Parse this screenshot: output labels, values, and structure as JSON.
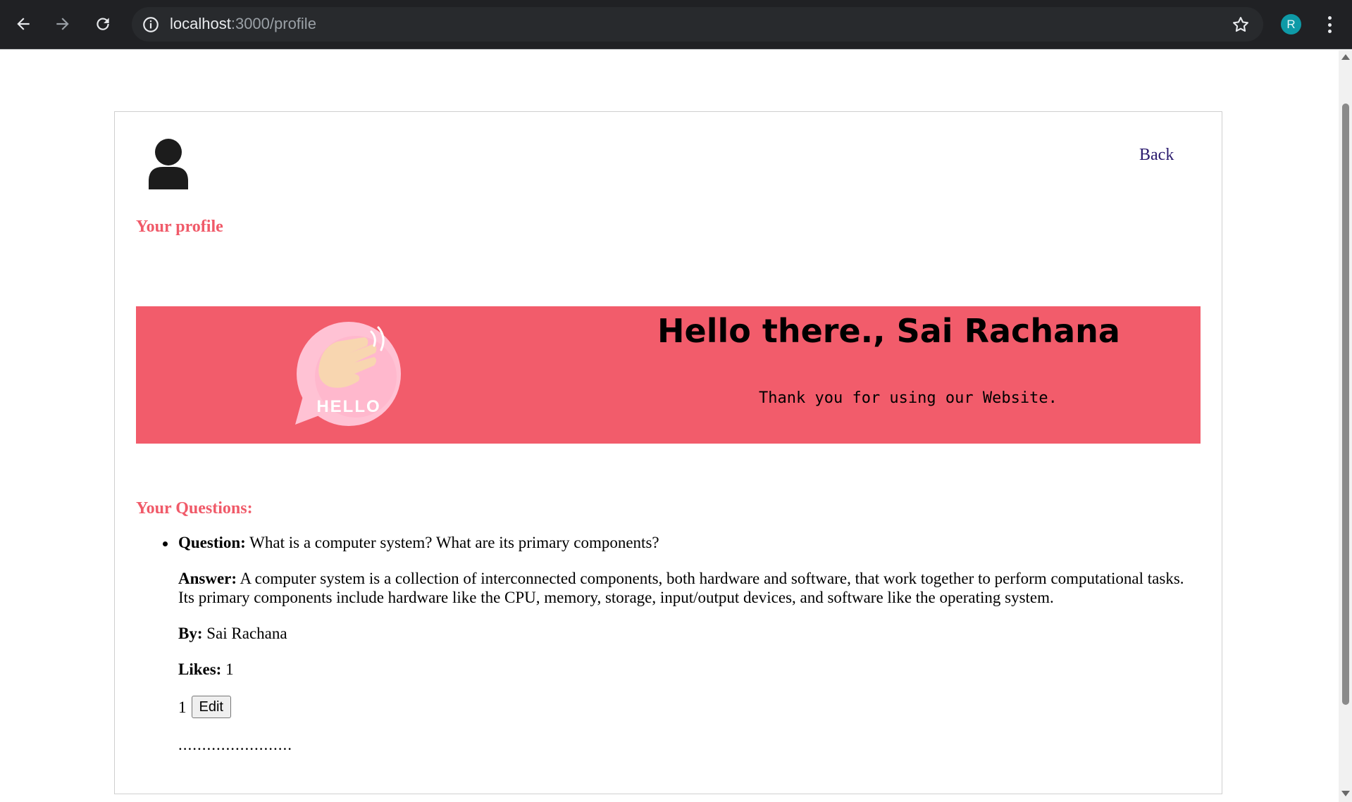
{
  "browser": {
    "url_host": "localhost",
    "url_path": ":3000/profile",
    "profile_initial": "R"
  },
  "header": {
    "back_label": "Back",
    "profile_heading": "Your profile"
  },
  "banner": {
    "title": "Hello there., Sai Rachana",
    "subtitle": "Thank you for using our Website.",
    "hello_badge_text": "HELLO",
    "background_color": "#f25c6b"
  },
  "questions": {
    "heading": "Your Questions:",
    "items": [
      {
        "question_label": "Question:",
        "question": " What is a computer system? What are its primary components?",
        "answer_label": "Answer:",
        "answer": " A computer system is a collection of interconnected components, both hardware and software, that work together to perform computational tasks. Its primary components include hardware like the CPU, memory, storage, input/output devices, and software like the operating system.",
        "by_label": "By:",
        "by": " Sai Rachana",
        "likes_label": "Likes:",
        "likes": " 1",
        "like_count": "1",
        "edit_label": "Edit",
        "separator": "........................"
      }
    ]
  },
  "colors": {
    "accent": "#f05a69",
    "link": "#2a1a6e"
  }
}
